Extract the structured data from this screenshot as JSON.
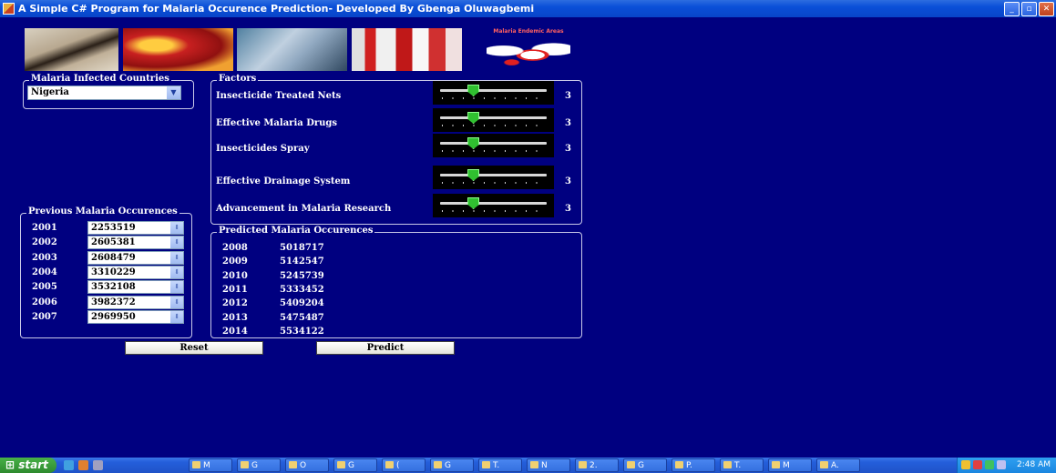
{
  "window": {
    "title": "A Simple C# Program for Malaria Occurence Prediction- Developed By Gbenga Oluwagbemi",
    "buttons": [
      "_",
      "▫",
      "✕"
    ]
  },
  "banner": {
    "map_title": "Malaria Endemic Areas"
  },
  "countries": {
    "legend": "Malaria Infected Countries",
    "selected": "Nigeria"
  },
  "factors": {
    "legend": "Factors",
    "items": [
      {
        "label": "Insecticide Treated Nets",
        "value": "3",
        "level": 3,
        "max": 10
      },
      {
        "label": "Effective Malaria Drugs",
        "value": "3",
        "level": 3,
        "max": 10
      },
      {
        "label": "Insecticides Spray",
        "value": "3",
        "level": 3,
        "max": 10
      },
      {
        "label": "Effective Drainage System",
        "value": "3",
        "level": 3,
        "max": 10
      },
      {
        "label": "Advancement in Malaria Research",
        "value": "3",
        "level": 3,
        "max": 10
      }
    ]
  },
  "previous": {
    "legend": "Previous Malaria Occurences",
    "rows": [
      {
        "year": "2001",
        "value": "2253519"
      },
      {
        "year": "2002",
        "value": "2605381"
      },
      {
        "year": "2003",
        "value": "2608479"
      },
      {
        "year": "2004",
        "value": "3310229"
      },
      {
        "year": "2005",
        "value": "3532108"
      },
      {
        "year": "2006",
        "value": "3982372"
      },
      {
        "year": "2007",
        "value": "2969950"
      }
    ]
  },
  "predicted": {
    "legend": "Predicted Malaria Occurences",
    "rows": [
      {
        "year": "2008",
        "value": "5018717"
      },
      {
        "year": "2009",
        "value": "5142547"
      },
      {
        "year": "2010",
        "value": "5245739"
      },
      {
        "year": "2011",
        "value": "5333452"
      },
      {
        "year": "2012",
        "value": "5409204"
      },
      {
        "year": "2013",
        "value": "5475487"
      },
      {
        "year": "2014",
        "value": "5534122"
      }
    ]
  },
  "actions": {
    "reset": "Reset",
    "predict": "Predict"
  },
  "taskbar": {
    "start": "start",
    "tasks": [
      "M",
      "G",
      "O",
      "G",
      "(",
      "G",
      "T.",
      "N",
      "2.",
      "G",
      "P.",
      "T.",
      "M",
      "A."
    ],
    "clock": "2:48 AM"
  }
}
